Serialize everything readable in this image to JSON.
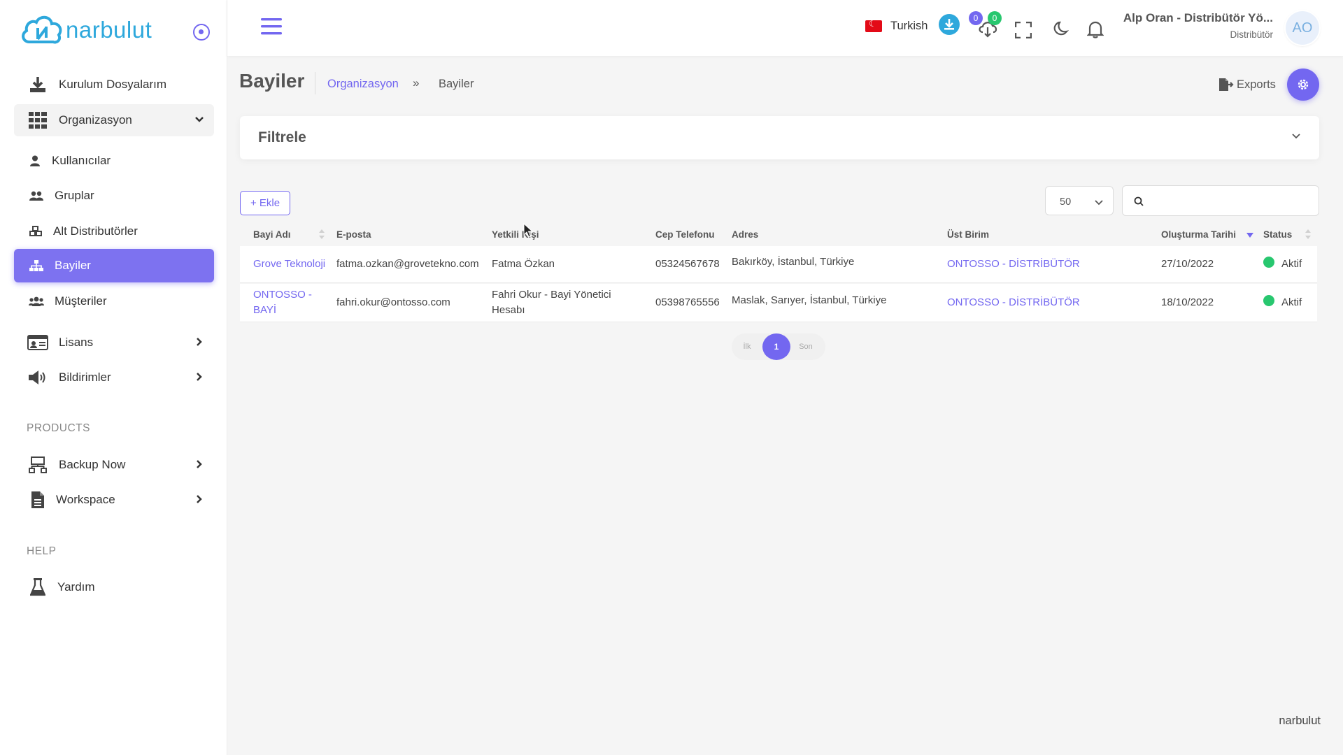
{
  "brand": {
    "name": "narbulut"
  },
  "sidebar": {
    "items": [
      {
        "label": "Kurulum Dosyalarım"
      },
      {
        "label": "Organizasyon"
      },
      {
        "label": "Kullanıcılar"
      },
      {
        "label": "Gruplar"
      },
      {
        "label": "Alt Distributörler"
      },
      {
        "label": "Bayiler"
      },
      {
        "label": "Müşteriler"
      },
      {
        "label": "Lisans"
      },
      {
        "label": "Bildirimler"
      }
    ],
    "products_title": "PRODUCTS",
    "products": [
      {
        "label": "Backup Now"
      },
      {
        "label": "Workspace"
      }
    ],
    "help_title": "HELP",
    "help": [
      {
        "label": "Yardım"
      }
    ]
  },
  "header": {
    "language": "Turkish",
    "badge_blue": "0",
    "badge_green": "0",
    "user_name": "Alp Oran - Distribütör Yö...",
    "user_role": "Distribütör",
    "avatar_initials": "AO"
  },
  "page": {
    "title": "Bayiler",
    "breadcrumb_parent": "Organizasyon",
    "breadcrumb_sep": "»",
    "breadcrumb_current": "Bayiler",
    "exports_label": "Exports"
  },
  "filter": {
    "title": "Filtrele"
  },
  "toolbar": {
    "add_label": "+ Ekle",
    "page_size": "50",
    "search_placeholder": ""
  },
  "table": {
    "columns": [
      "Bayi Adı",
      "E-posta",
      "Yetkili Kişi",
      "Cep Telefonu",
      "Adres",
      "Üst Birim",
      "Oluşturma Tarihi",
      "Status"
    ],
    "rows": [
      {
        "name": "Grove Teknoloji",
        "email": "fatma.ozkan@grovetekno.com",
        "contact": "Fatma Özkan",
        "phone": "05324567678",
        "address": "Bakırköy, İstanbul, Türkiye",
        "parent": "ONTOSSO - DİSTRİBÜTÖR",
        "created": "27/10/2022",
        "status": "Aktif"
      },
      {
        "name_line1": "ONTOSSO -",
        "name_line2": "BAYİ",
        "email": "fahri.okur@ontosso.com",
        "contact_line1": "Fahri Okur - Bayi Yönetici",
        "contact_line2": "Hesabı",
        "phone": "05398765556",
        "address": "Maslak, Sarıyer, İstanbul, Türkiye",
        "parent": "ONTOSSO - DİSTRİBÜTÖR",
        "created": "18/10/2022",
        "status": "Aktif"
      }
    ]
  },
  "pagination": {
    "first": "İlk",
    "current": "1",
    "last": "Son"
  },
  "footer": {
    "text": "narbulut"
  },
  "colors": {
    "accent": "#7367f0",
    "brand": "#2ea8dc",
    "success": "#28c76f"
  }
}
